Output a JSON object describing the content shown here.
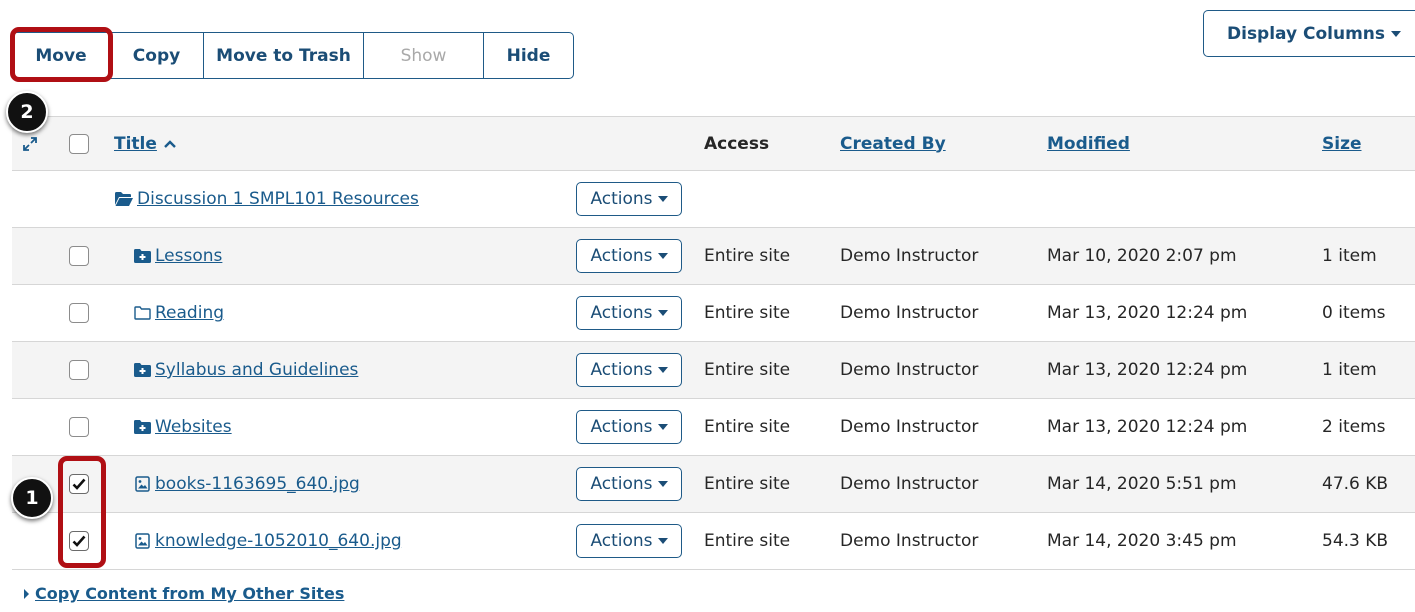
{
  "toolbar": {
    "move": "Move",
    "copy": "Copy",
    "trash": "Move to Trash",
    "show": "Show",
    "hide": "Hide",
    "display_columns": "Display Columns"
  },
  "callouts": {
    "step1": "1",
    "step2": "2"
  },
  "table": {
    "headers": {
      "title": "Title",
      "access": "Access",
      "created_by": "Created By",
      "modified": "Modified",
      "size": "Size"
    },
    "actions_label": "Actions",
    "root_folder": "Discussion 1 SMPL101 Resources",
    "rows": [
      {
        "title": "Lessons",
        "icon": "folder-plus-icon",
        "access": "Entire site",
        "created_by": "Demo Instructor",
        "modified": "Mar 10, 2020 2:07 pm",
        "size": "1 item",
        "checked": false
      },
      {
        "title": "Reading",
        "icon": "folder-outline-icon",
        "access": "Entire site",
        "created_by": "Demo Instructor",
        "modified": "Mar 13, 2020 12:24 pm",
        "size": "0 items",
        "checked": false
      },
      {
        "title": "Syllabus and Guidelines",
        "icon": "folder-plus-icon",
        "access": "Entire site",
        "created_by": "Demo Instructor",
        "modified": "Mar 13, 2020 12:24 pm",
        "size": "1 item",
        "checked": false
      },
      {
        "title": "Websites",
        "icon": "folder-plus-icon",
        "access": "Entire site",
        "created_by": "Demo Instructor",
        "modified": "Mar 13, 2020 12:24 pm",
        "size": "2 items",
        "checked": false
      },
      {
        "title": "books-1163695_640.jpg",
        "icon": "image-file-icon",
        "access": "Entire site",
        "created_by": "Demo Instructor",
        "modified": "Mar 14, 2020 5:51 pm",
        "size": "47.6 KB",
        "checked": true
      },
      {
        "title": "knowledge-1052010_640.jpg",
        "icon": "image-file-icon",
        "access": "Entire site",
        "created_by": "Demo Instructor",
        "modified": "Mar 14, 2020 3:45 pm",
        "size": "54.3 KB",
        "checked": true
      }
    ]
  },
  "footer": {
    "copy_content": "Copy Content from My Other Sites"
  },
  "colors": {
    "link": "#1a5b8c",
    "button_border": "#1f5a87",
    "callout": "#b00f14",
    "row_stripe": "#f4f4f4"
  }
}
